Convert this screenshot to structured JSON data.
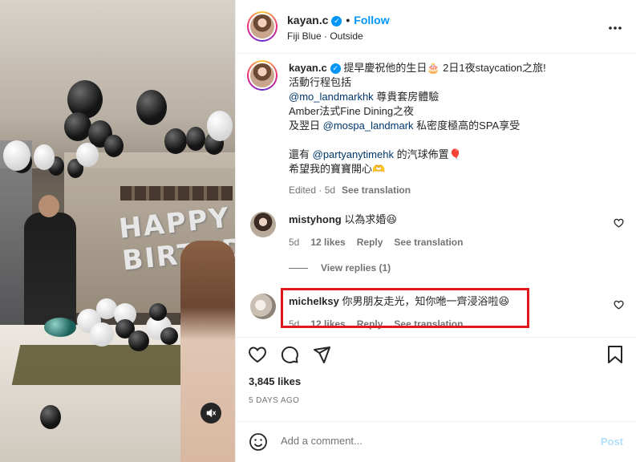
{
  "header": {
    "username": "kayan.c",
    "follow_label": "Follow",
    "subtitle": "Fiji Blue · Outside",
    "more_icon": "more-horizontal-icon"
  },
  "media": {
    "banner_text": "HAPPY BIRTHDAY"
  },
  "caption": {
    "username": "kayan.c",
    "line1": "提早慶祝他的生日🎂 2日1夜staycation之旅!",
    "line2": "活動行程包括",
    "mention1": "@mo_landmarkhk",
    "line3_rest": " 尊貴套房體驗",
    "line4": "Amber法式Fine Dining之夜",
    "line5_pre": "及翌日 ",
    "mention2": "@mospa_landmark",
    "line5_rest": " 私密度極高的SPA享受",
    "line6_pre": "還有 ",
    "mention3": "@partyanytimehk",
    "line6_rest": " 的汽球佈置🎈",
    "line7": "希望我的寶寶開心🫶",
    "edited": "Edited · 5d",
    "see_translation": "See translation"
  },
  "comments": [
    {
      "username": "mistyhong",
      "text": "以為求婚😆",
      "age": "5d",
      "likes": "12 likes",
      "reply": "Reply",
      "see_translation": "See translation"
    },
    {
      "username": "michelksy",
      "text": "你男朋友走光，知你咃一齊浸浴啦😆",
      "age": "5d",
      "likes": "12 likes",
      "reply": "Reply",
      "see_translation": "See translation"
    }
  ],
  "view_replies": "View replies (1)",
  "likes_count": "3,845 likes",
  "post_date": "5 DAYS AGO",
  "add_comment": {
    "placeholder": "Add a comment...",
    "post_label": "Post"
  },
  "colors": {
    "accent": "#0095f6",
    "highlight_box": "#e0191f",
    "post_disabled": "#b2dffc"
  }
}
